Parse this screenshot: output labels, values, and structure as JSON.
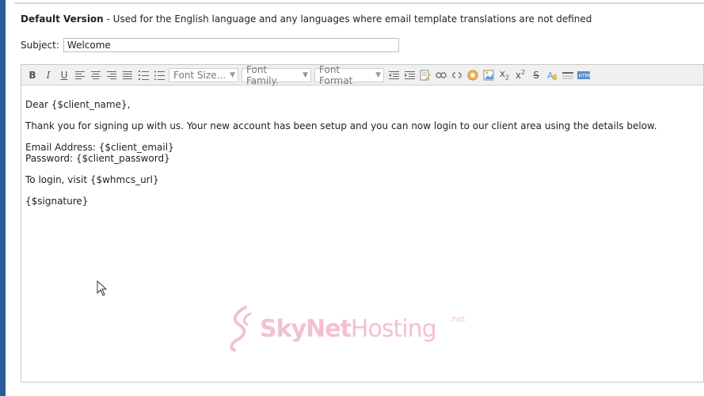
{
  "heading": {
    "bold": "Default Version",
    "rest": " - Used for the English language and any languages where email template translations are not defined"
  },
  "subject": {
    "label": "Subject:",
    "value": "Welcome"
  },
  "toolbar": {
    "bold": "B",
    "italic": "I",
    "underline": "U",
    "font_size": "Font Size...",
    "font_family": "Font Family.",
    "font_format": "Font Format"
  },
  "body": {
    "line1": "Dear {$client_name},",
    "line2": "Thank you for signing up with us. Your new account has been setup and you can now login to our client area using the details below.",
    "line3": "Email Address: {$client_email}",
    "line4": "Password: {$client_password}",
    "line5": "To login, visit {$whmcs_url}",
    "line6": "{$signature}"
  },
  "watermark": {
    "brand": "SkyNet",
    "brand2": "Hosting",
    "suffix": ".net"
  },
  "colors": {
    "accent": "#2a5e9a",
    "watermark": "#f3c0d2"
  }
}
